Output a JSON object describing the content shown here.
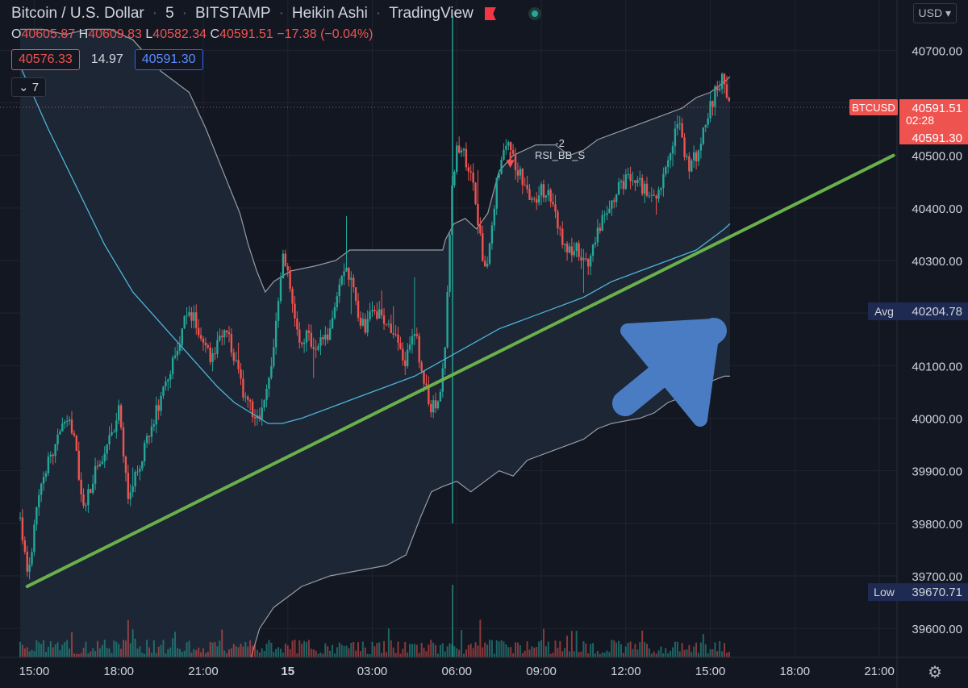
{
  "header": {
    "symbol": "Bitcoin / U.S. Dollar",
    "interval": "5",
    "exchange": "BITSTAMP",
    "chart_style": "Heikin Ashi",
    "source": "TradingView",
    "separator": "·"
  },
  "ohlc": {
    "o_label": "O",
    "o": "40605.87",
    "h_label": "H",
    "h": "40609.83",
    "l_label": "L",
    "l": "40582.34",
    "c_label": "C",
    "c": "40591.51",
    "change": "−17.38 (−0.04%)"
  },
  "quote": {
    "sell": "40576.33",
    "spread": "14.97",
    "buy": "40591.30"
  },
  "indicators_collapsed": "7",
  "currency": "USD",
  "indicator_label": {
    "value": "-2",
    "name": "RSI_BB_S"
  },
  "colors": {
    "background": "#131722",
    "up": "#26a69a",
    "down": "#ef5350",
    "trendline": "#6ab04c",
    "arrow": "#4a7cc4",
    "band": "#b0b3ba",
    "ma": "#4fb3d9"
  },
  "chart_data": {
    "type": "candlestick",
    "title": "Bitcoin / U.S. Dollar · 5 · BITSTAMP · Heikin Ashi",
    "y_ticks": [
      39600,
      39700,
      39800,
      39900,
      40000,
      40100,
      40200,
      40300,
      40400,
      40500,
      40600,
      40700
    ],
    "y_tick_labels": [
      "39600.00",
      "39700.00",
      "39800.00",
      "39900.00",
      "40000.00",
      "40100.00",
      "",
      "40300.00",
      "40400.00",
      "40500.00",
      "",
      "40700.00"
    ],
    "ylim": [
      39545,
      40765
    ],
    "x_ticks": [
      {
        "label": "15:00",
        "t": 0.5
      },
      {
        "label": "18:00",
        "t": 3.5
      },
      {
        "label": "21:00",
        "t": 6.5
      },
      {
        "label": "15",
        "t": 9.5,
        "bold": true
      },
      {
        "label": "03:00",
        "t": 12.5
      },
      {
        "label": "06:00",
        "t": 15.5
      },
      {
        "label": "09:00",
        "t": 18.5
      },
      {
        "label": "12:00",
        "t": 21.5
      },
      {
        "label": "15:00",
        "t": 24.5
      },
      {
        "label": "18:00",
        "t": 27.5
      },
      {
        "label": "21:00",
        "t": 30.5
      }
    ],
    "x_unit": "hours since 14:30 on the 14th",
    "xlim": [
      -0.2,
      31.7
    ],
    "price_series": [
      [
        0.0,
        39810
      ],
      [
        0.15,
        39740
      ],
      [
        0.3,
        39700
      ],
      [
        0.5,
        39790
      ],
      [
        0.7,
        39880
      ],
      [
        1.0,
        39920
      ],
      [
        1.3,
        39960
      ],
      [
        1.6,
        40000
      ],
      [
        1.9,
        39970
      ],
      [
        2.1,
        39880
      ],
      [
        2.3,
        39830
      ],
      [
        2.6,
        39890
      ],
      [
        2.9,
        39920
      ],
      [
        3.2,
        39960
      ],
      [
        3.5,
        40010
      ],
      [
        3.7,
        39920
      ],
      [
        3.85,
        39840
      ],
      [
        4.1,
        39890
      ],
      [
        4.4,
        39940
      ],
      [
        4.8,
        40010
      ],
      [
        5.2,
        40070
      ],
      [
        5.6,
        40130
      ],
      [
        5.9,
        40200
      ],
      [
        6.2,
        40190
      ],
      [
        6.5,
        40150
      ],
      [
        6.8,
        40110
      ],
      [
        7.1,
        40170
      ],
      [
        7.4,
        40160
      ],
      [
        7.7,
        40090
      ],
      [
        8.0,
        40040
      ],
      [
        8.3,
        40000
      ],
      [
        8.6,
        40010
      ],
      [
        8.9,
        40080
      ],
      [
        9.1,
        40200
      ],
      [
        9.3,
        40300
      ],
      [
        9.5,
        40290
      ],
      [
        9.7,
        40200
      ],
      [
        9.9,
        40140
      ],
      [
        10.2,
        40160
      ],
      [
        10.5,
        40130
      ],
      [
        10.8,
        40150
      ],
      [
        11.0,
        40170
      ],
      [
        11.3,
        40260
      ],
      [
        11.6,
        40290
      ],
      [
        11.9,
        40220
      ],
      [
        12.2,
        40170
      ],
      [
        12.5,
        40210
      ],
      [
        12.8,
        40200
      ],
      [
        13.1,
        40170
      ],
      [
        13.4,
        40140
      ],
      [
        13.7,
        40110
      ],
      [
        14.0,
        40170
      ],
      [
        14.3,
        40080
      ],
      [
        14.6,
        40020
      ],
      [
        14.9,
        40030
      ],
      [
        15.1,
        40140
      ],
      [
        15.3,
        40420
      ],
      [
        15.5,
        40520
      ],
      [
        15.7,
        40510
      ],
      [
        15.9,
        40470
      ],
      [
        16.1,
        40450
      ],
      [
        16.3,
        40350
      ],
      [
        16.5,
        40280
      ],
      [
        16.7,
        40340
      ],
      [
        16.9,
        40440
      ],
      [
        17.1,
        40510
      ],
      [
        17.3,
        40540
      ],
      [
        17.6,
        40480
      ],
      [
        17.9,
        40450
      ],
      [
        18.2,
        40400
      ],
      [
        18.5,
        40440
      ],
      [
        18.8,
        40420
      ],
      [
        19.1,
        40370
      ],
      [
        19.4,
        40310
      ],
      [
        19.7,
        40330
      ],
      [
        20.0,
        40300
      ],
      [
        20.2,
        40290
      ],
      [
        20.4,
        40340
      ],
      [
        20.7,
        40390
      ],
      [
        21.0,
        40420
      ],
      [
        21.3,
        40440
      ],
      [
        21.6,
        40460
      ],
      [
        21.9,
        40460
      ],
      [
        22.2,
        40430
      ],
      [
        22.5,
        40410
      ],
      [
        22.8,
        40460
      ],
      [
        23.1,
        40520
      ],
      [
        23.4,
        40560
      ],
      [
        23.7,
        40480
      ],
      [
        24.0,
        40500
      ],
      [
        24.3,
        40560
      ],
      [
        24.6,
        40610
      ],
      [
        24.9,
        40650
      ],
      [
        25.2,
        40600
      ]
    ],
    "candle_seed": 20250315,
    "upper_band": [
      [
        0.0,
        40740
      ],
      [
        0.8,
        40740
      ],
      [
        1.6,
        40730
      ],
      [
        2.4,
        40740
      ],
      [
        3.2,
        40740
      ],
      [
        4.0,
        40720
      ],
      [
        5.0,
        40660
      ],
      [
        6.0,
        40620
      ],
      [
        6.6,
        40550
      ],
      [
        7.2,
        40470
      ],
      [
        7.8,
        40390
      ],
      [
        8.1,
        40330
      ],
      [
        8.4,
        40280
      ],
      [
        8.7,
        40240
      ],
      [
        9.0,
        40260
      ],
      [
        9.6,
        40280
      ],
      [
        10.5,
        40290
      ],
      [
        11.2,
        40300
      ],
      [
        11.7,
        40320
      ],
      [
        12.3,
        40320
      ],
      [
        13.0,
        40320
      ],
      [
        14.0,
        40320
      ],
      [
        15.0,
        40320
      ],
      [
        15.1,
        40340
      ],
      [
        15.4,
        40370
      ],
      [
        15.8,
        40380
      ],
      [
        16.2,
        40360
      ],
      [
        16.6,
        40390
      ],
      [
        17.0,
        40470
      ],
      [
        17.5,
        40500
      ],
      [
        18.3,
        40520
      ],
      [
        19.0,
        40520
      ],
      [
        19.5,
        40500
      ],
      [
        20.0,
        40510
      ],
      [
        20.5,
        40530
      ],
      [
        21.0,
        40540
      ],
      [
        21.5,
        40550
      ],
      [
        22.0,
        40560
      ],
      [
        22.5,
        40570
      ],
      [
        23.0,
        40580
      ],
      [
        23.5,
        40590
      ],
      [
        24.0,
        40610
      ],
      [
        24.5,
        40620
      ],
      [
        25.0,
        40640
      ],
      [
        25.2,
        40650
      ]
    ],
    "lower_band": [
      [
        8.2,
        39545
      ],
      [
        8.5,
        39600
      ],
      [
        9.0,
        39640
      ],
      [
        10.0,
        39680
      ],
      [
        11.0,
        39700
      ],
      [
        12.0,
        39710
      ],
      [
        13.0,
        39720
      ],
      [
        13.7,
        39740
      ],
      [
        14.2,
        39810
      ],
      [
        14.6,
        39860
      ],
      [
        15.0,
        39870
      ],
      [
        15.5,
        39880
      ],
      [
        16.0,
        39860
      ],
      [
        16.5,
        39880
      ],
      [
        17.0,
        39900
      ],
      [
        17.5,
        39890
      ],
      [
        18.0,
        39920
      ],
      [
        19.0,
        39940
      ],
      [
        20.0,
        39960
      ],
      [
        20.5,
        39980
      ],
      [
        21.0,
        39990
      ],
      [
        22.0,
        40000
      ],
      [
        22.5,
        40010
      ],
      [
        23.0,
        40030
      ],
      [
        23.5,
        40040
      ],
      [
        24.0,
        40060
      ],
      [
        24.5,
        40070
      ],
      [
        25.0,
        40080
      ],
      [
        25.2,
        40080
      ]
    ],
    "moving_average": [
      [
        0.0,
        40670
      ],
      [
        1.0,
        40550
      ],
      [
        2.0,
        40440
      ],
      [
        3.0,
        40330
      ],
      [
        4.0,
        40240
      ],
      [
        5.0,
        40180
      ],
      [
        6.0,
        40120
      ],
      [
        7.0,
        40060
      ],
      [
        7.6,
        40030
      ],
      [
        8.2,
        40010
      ],
      [
        8.8,
        39990
      ],
      [
        9.3,
        39990
      ],
      [
        10.0,
        40000
      ],
      [
        11.0,
        40020
      ],
      [
        12.0,
        40040
      ],
      [
        13.0,
        40060
      ],
      [
        14.0,
        40080
      ],
      [
        15.0,
        40110
      ],
      [
        16.0,
        40140
      ],
      [
        17.0,
        40170
      ],
      [
        18.0,
        40190
      ],
      [
        19.0,
        40210
      ],
      [
        20.0,
        40230
      ],
      [
        21.0,
        40260
      ],
      [
        22.0,
        40280
      ],
      [
        23.0,
        40300
      ],
      [
        24.0,
        40320
      ],
      [
        25.0,
        40360
      ],
      [
        25.2,
        40370
      ]
    ],
    "trendline": {
      "from": [
        0.25,
        39680
      ],
      "to": [
        31.0,
        40500
      ]
    },
    "current_price": 40591.51,
    "price_labels": [
      {
        "name": "BTCUSD",
        "value": "40591.51",
        "extra": "02:28",
        "bid": "40591.30",
        "y": 40591.51,
        "kind": "current"
      },
      {
        "name": "Avg",
        "value": "40204.78",
        "y": 40204.78,
        "kind": "info"
      },
      {
        "name": "Low",
        "value": "39670.71",
        "y": 39670.71,
        "kind": "info"
      }
    ],
    "marker": {
      "t": 17.4,
      "price": 40470
    },
    "grid": true,
    "legend": "none"
  }
}
